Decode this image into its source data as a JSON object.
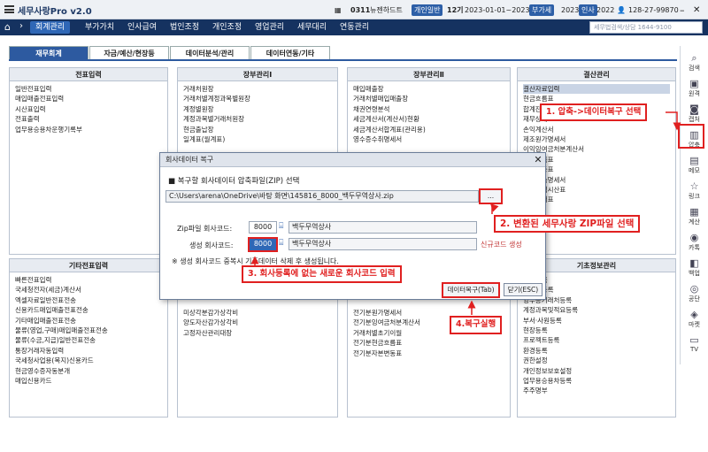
{
  "titlebar": {
    "app": "세무사랑Pro v2.0",
    "company_code": "0311",
    "company_name": "뉴젠하드트",
    "badge_type": "개인일반",
    "period": "12기",
    "period_dates": "2023-01-01~2023-12-31",
    "badge_vat": "부가세",
    "year": "2023",
    "badge_personnel": "인사",
    "personnel_year": "2022",
    "biz_number": "128-27-99870"
  },
  "nav": {
    "items": [
      "회계관리",
      "부가가치",
      "인사급여",
      "법인조정",
      "개인조정",
      "영업관리",
      "세무대리",
      "연동관리"
    ],
    "search_placeholder": "세무법검색/상담 1644-9100"
  },
  "tabs": [
    "재무회계",
    "자금/예산/현장등",
    "데이터분석/관리",
    "데이터연동/기타"
  ],
  "panels": {
    "p1": {
      "title": "전표입력",
      "items": [
        "일반전표입력",
        "매입매출전표입력",
        "시산표입력",
        "전표출력",
        "업무용승용차운행기록부"
      ]
    },
    "p2": {
      "title": "장부관리Ⅰ",
      "items": [
        "거래처원장",
        "거래처별계정과목별원장",
        "계정별원장",
        "계정과목별거래처원장",
        "현금출납장",
        "일계표(월계표)"
      ]
    },
    "p3": {
      "title": "장부관리Ⅱ",
      "items": [
        "매입매출장",
        "거래처별매입매출장",
        "채권연령분석",
        "세금계산서(계산서)현황",
        "세금계산서합계표(관리용)",
        "영수증수취명세서"
      ]
    },
    "p4": {
      "title": "결산관리",
      "items": [
        "결산자료입력",
        "현금흐름표",
        "합계잔액시산표",
        "재무상태표",
        "손익계산서",
        "제조원가명세서",
        "이익잉여금처분계산서",
        "현금흐름표",
        "자본변동표",
        "결산부속명세서",
        "합계잔액시산표",
        "재무상태표"
      ]
    },
    "p5": {
      "title": "기타전표입력",
      "items": [
        "빠른전표입력",
        "국세청전자(세금)계산서",
        "엑셀자료일반전표전송",
        "신용카드매입매출전표전송",
        "기타매입매출전표전송",
        "물류(영업,구매)매입매출전표전송",
        "물류(수금,지급)일반전표전송",
        "통장거래자동입력",
        "국세청사업용(복지)신용카드",
        "현금영수증자동분개",
        "매입신용카드"
      ]
    },
    "p6": {
      "title": "",
      "items": [
        "미상각분감가상각비",
        "양도자산감가상각비",
        "고정자산관리대장"
      ]
    },
    "p7": {
      "title": "",
      "items": [
        "전기분원가명세서",
        "전기분잉여금처분계산서",
        "거래처별초기이월",
        "전기분현금흐름표",
        "전기분자본변동표"
      ]
    },
    "p8": {
      "title": "기초정보관리",
      "items": [
        "회사등록",
        "거래처등록",
        "영수증거래처등록",
        "계정과목및적요등록",
        "부서·사원등록",
        "현장등록",
        "프로젝트등록",
        "환경등록",
        "권한설정",
        "개인정보보호설정",
        "업무용승용차등록",
        "주주명부"
      ]
    }
  },
  "sidebar": [
    {
      "icon": "search-icon",
      "label": "검색"
    },
    {
      "icon": "book-icon",
      "label": "원격"
    },
    {
      "icon": "camera-icon",
      "label": "캡처"
    },
    {
      "icon": "archive-icon",
      "label": "압축"
    },
    {
      "icon": "memo-icon",
      "label": "메모"
    },
    {
      "icon": "star-icon",
      "label": "링크"
    },
    {
      "icon": "calculator-icon",
      "label": "계산"
    },
    {
      "icon": "chat-icon",
      "label": "카톡"
    },
    {
      "icon": "backup-icon",
      "label": "백업"
    },
    {
      "icon": "coin-icon",
      "label": "공단"
    },
    {
      "icon": "market-icon",
      "label": "마켓"
    },
    {
      "icon": "tv-icon",
      "label": "TV"
    }
  ],
  "dialog": {
    "title": "회사데이터 복구",
    "heading": "■ 복구할 회사데이터 압축파일(ZIP) 선택",
    "file_path": "C:\\Users\\arena\\OneDrive\\바탕 화면\\145816_8000_백두무역상사.zip",
    "browse_label": "...",
    "zip_code_label": "Zip파일 회사코드:",
    "zip_code": "8000",
    "zip_company": "백두무역상사",
    "new_code_label": "생성 회사코드:",
    "new_code": "8000",
    "new_company": "백두무역상사",
    "new_code_note": "신규코드 생성",
    "note": "※ 생성 회사코드 중복시 기존데이터 삭제 후 생성됩니다.",
    "restore_button": "데이터복구(Tab)",
    "close_button": "닫기(ESC)"
  },
  "callouts": {
    "c1": "1. 압축->데이터복구 선택",
    "c2": "2. 변환된 세무사랑 ZIP파일 선택",
    "c3": "3. 회사등록에 없는 새로운 회사코드 입력",
    "c4": "4.복구실행"
  },
  "colors": {
    "nav": "#153260",
    "accent": "#2d5aa0",
    "callout": "#e02020",
    "highlight": "#2f67b6"
  }
}
